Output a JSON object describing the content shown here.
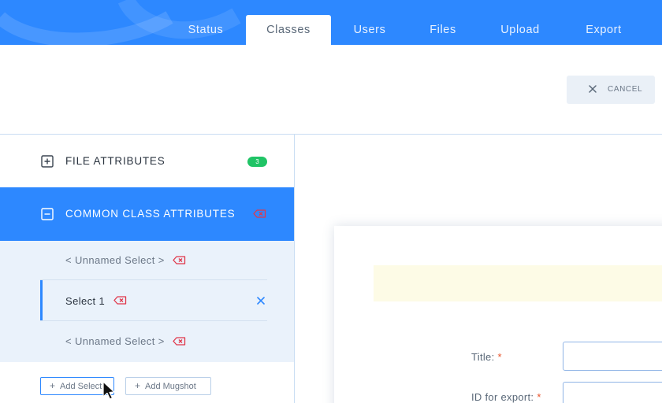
{
  "nav": {
    "tabs": [
      {
        "label": "Status",
        "active": false
      },
      {
        "label": "Classes",
        "active": true
      },
      {
        "label": "Users",
        "active": false
      },
      {
        "label": "Files",
        "active": false
      },
      {
        "label": "Upload",
        "active": false
      },
      {
        "label": "Export",
        "active": false
      }
    ]
  },
  "toolbar": {
    "cancel_label": "CANCEL",
    "cancel_icon": "close-icon"
  },
  "sidebar": {
    "file_attributes": {
      "label": "FILE ATTRIBUTES",
      "icon": "plus-square-icon",
      "count": "3"
    },
    "common_class_attributes": {
      "label": "COMMON CLASS ATTRIBUTES",
      "icon": "minus-square-icon",
      "expanded": true
    },
    "selects": [
      {
        "label": "< Unnamed Select >",
        "selected": false
      },
      {
        "label": "Select 1",
        "selected": true
      },
      {
        "label": "< Unnamed Select >",
        "selected": false
      }
    ],
    "add_select_label": "Add Select",
    "add_mugshot_label": "Add Mugshot"
  },
  "form": {
    "title_label": "Title:",
    "id_label": "ID for export:",
    "required_mark": "*",
    "title_value": "",
    "id_value": ""
  },
  "colors": {
    "brand": "#2d88ff",
    "badge": "#20c466",
    "delete": "#e0374a",
    "required": "#e8532b",
    "notice": "#fdfbe6"
  }
}
